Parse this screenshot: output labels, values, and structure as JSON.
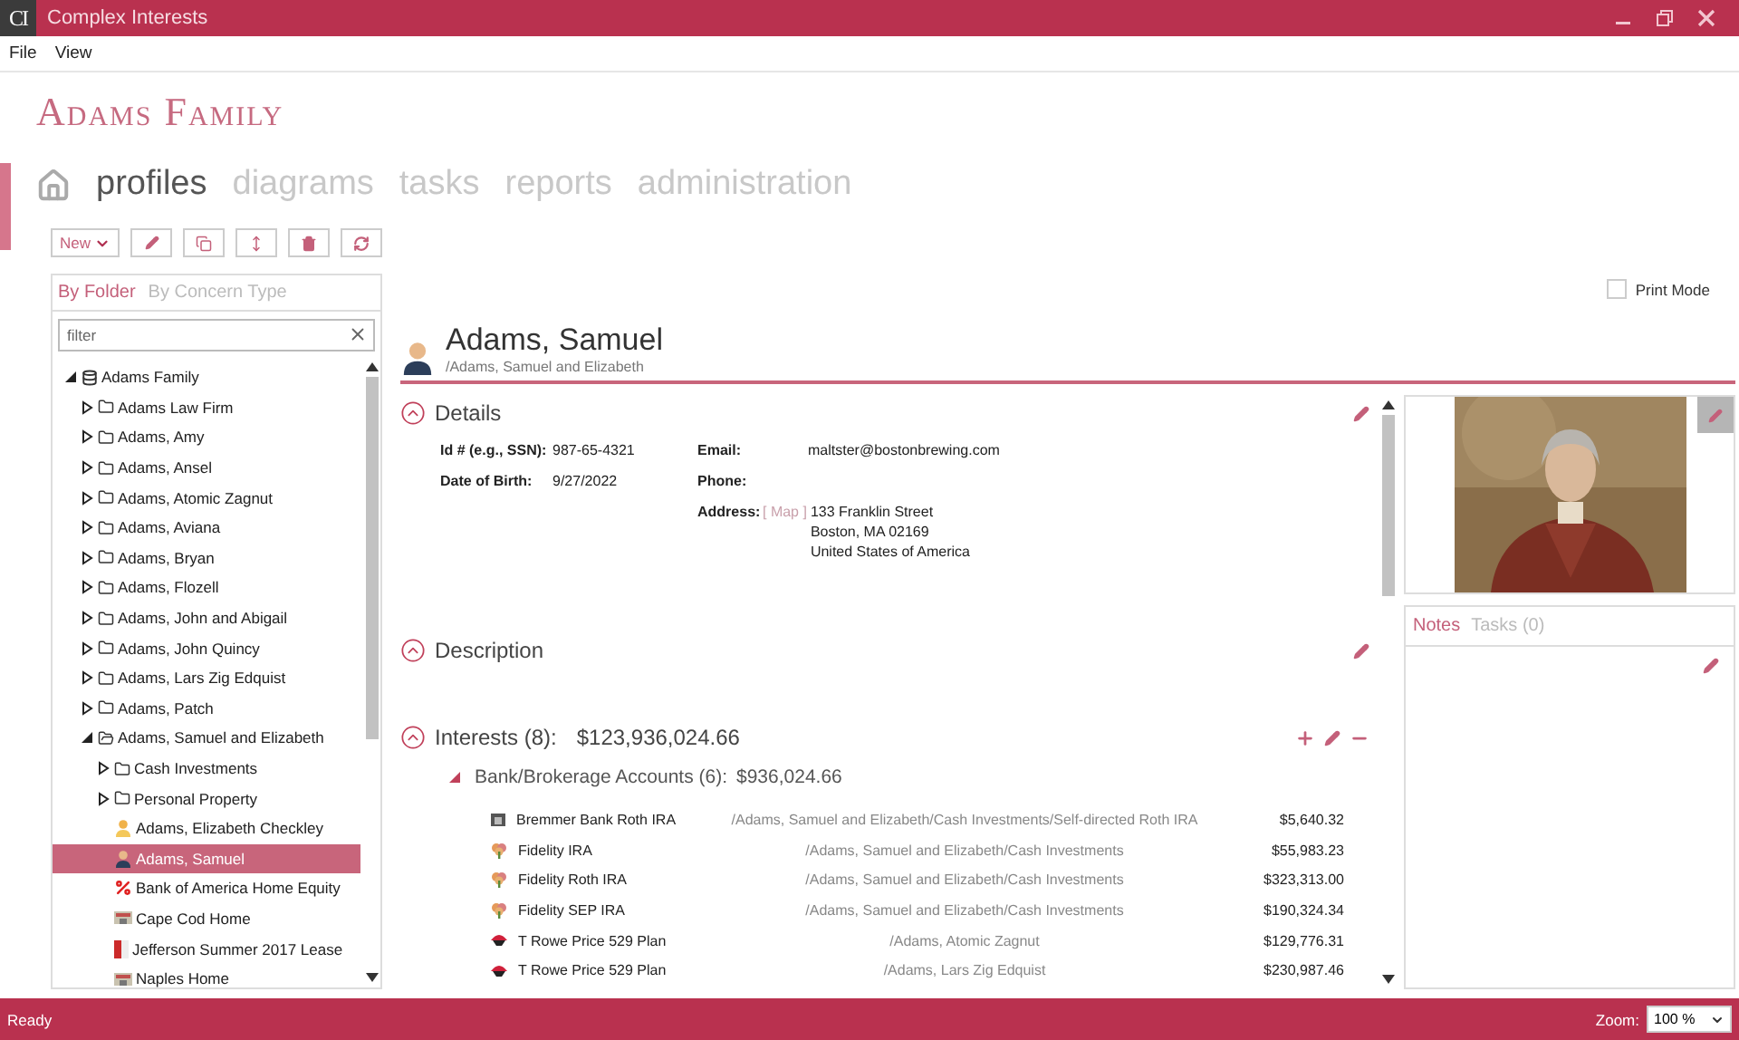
{
  "window": {
    "logo": "CI",
    "title": "Complex Interests"
  },
  "menu": [
    "File",
    "View"
  ],
  "family_title": "Adams Family",
  "nav": [
    {
      "label": "profiles",
      "selected": true
    },
    {
      "label": "diagrams",
      "selected": false
    },
    {
      "label": "tasks",
      "selected": false
    },
    {
      "label": "reports",
      "selected": false
    },
    {
      "label": "administration",
      "selected": false
    }
  ],
  "toolbar": {
    "new_button": "New"
  },
  "sidebar": {
    "tabs": [
      {
        "label": "By Folder",
        "selected": true
      },
      {
        "label": "By Concern Type",
        "selected": false
      }
    ],
    "filter": {
      "placeholder": "filter"
    },
    "tree": [
      {
        "kind": "database",
        "label": "Adams Family",
        "expanded": true,
        "selected": false,
        "children": [
          {
            "kind": "folder",
            "label": "Adams Law Firm",
            "expanded": false,
            "selected": false
          },
          {
            "kind": "folder",
            "label": "Adams, Amy",
            "expanded": false,
            "selected": false
          },
          {
            "kind": "folder",
            "label": "Adams, Ansel",
            "expanded": false,
            "selected": false
          },
          {
            "kind": "folder",
            "label": "Adams, Atomic Zagnut",
            "expanded": false,
            "selected": false
          },
          {
            "kind": "folder",
            "label": "Adams, Aviana",
            "expanded": false,
            "selected": false
          },
          {
            "kind": "folder",
            "label": "Adams, Bryan",
            "expanded": false,
            "selected": false
          },
          {
            "kind": "folder",
            "label": "Adams, Flozell",
            "expanded": false,
            "selected": false
          },
          {
            "kind": "folder",
            "label": "Adams, John and Abigail",
            "expanded": false,
            "selected": false
          },
          {
            "kind": "folder",
            "label": "Adams, John Quincy",
            "expanded": false,
            "selected": false
          },
          {
            "kind": "folder",
            "label": "Adams, Lars Zig Edquist",
            "expanded": false,
            "selected": false
          },
          {
            "kind": "folder",
            "label": "Adams, Patch",
            "expanded": false,
            "selected": false
          },
          {
            "kind": "folder",
            "label": "Adams, Samuel and Elizabeth",
            "expanded": true,
            "selected": false,
            "children": [
              {
                "kind": "folder",
                "label": "Cash Investments",
                "expanded": false,
                "selected": false
              },
              {
                "kind": "folder",
                "label": "Personal Property",
                "expanded": false,
                "selected": false
              },
              {
                "kind": "person_female",
                "label": "Adams, Elizabeth Checkley",
                "selected": false
              },
              {
                "kind": "person_male",
                "label": "Adams, Samuel",
                "selected": true
              },
              {
                "kind": "loan",
                "label": "Bank of America Home Equity",
                "selected": false
              },
              {
                "kind": "property",
                "label": "Cape Cod Home",
                "selected": false
              },
              {
                "kind": "lease",
                "label": "Jefferson Summer 2017 Lease",
                "selected": false
              },
              {
                "kind": "property",
                "label": "Naples Home",
                "selected": false
              }
            ]
          }
        ]
      }
    ]
  },
  "profile": {
    "name": "Adams, Samuel",
    "path": "/Adams, Samuel and Elizabeth",
    "print_mode": {
      "label": "Print Mode",
      "checked": false
    }
  },
  "details": {
    "title": "Details",
    "expanded": true,
    "columns": [
      [
        {
          "kind": "text",
          "label": "Id # (e.g., SSN):",
          "value": "987-65-4321"
        },
        {
          "kind": "text",
          "label": "Date of Birth:",
          "value": "9/27/2022"
        }
      ],
      [
        {
          "kind": "text",
          "label": "Email:",
          "value": "maltster@bostonbrewing.com"
        },
        {
          "kind": "text",
          "label": "Phone:"
        },
        {
          "kind": "address",
          "label": "Address:",
          "link": "[ Map ]",
          "lines": [
            "133 Franklin Street",
            "Boston, MA 02169",
            "United States of America"
          ]
        }
      ]
    ]
  },
  "description": {
    "title": "Description",
    "expanded": true
  },
  "interests": {
    "title": "Interests (8):",
    "total": "$123,936,024.66",
    "expanded": true,
    "groups": [
      {
        "title": "Bank/Brokerage Accounts (6):",
        "total": "$936,024.66",
        "expanded": true,
        "rows": [
          {
            "kind": "bank",
            "name": "Bremmer Bank Roth IRA",
            "path": "/Adams, Samuel and Elizabeth/Cash Investments/Self-directed Roth IRA",
            "amount": "$5,640.32"
          },
          {
            "kind": "fund",
            "name": "Fidelity IRA",
            "path": "/Adams, Samuel and Elizabeth/Cash Investments",
            "amount": "$55,983.23"
          },
          {
            "kind": "fund",
            "name": "Fidelity Roth IRA",
            "path": "/Adams, Samuel and Elizabeth/Cash Investments",
            "amount": "$323,313.00"
          },
          {
            "kind": "fund",
            "name": "Fidelity SEP IRA",
            "path": "/Adams, Samuel and Elizabeth/Cash Investments",
            "amount": "$190,324.34"
          },
          {
            "kind": "plan",
            "name": "T Rowe Price 529 Plan",
            "path": "/Adams, Atomic Zagnut",
            "amount": "$129,776.31"
          },
          {
            "kind": "plan",
            "name": "T Rowe Price 529 Plan",
            "path": "/Adams, Lars Zig Edquist",
            "amount": "$230,987.46"
          }
        ]
      }
    ]
  },
  "photo": {
    "kind": "picture"
  },
  "notes": {
    "tabs": [
      {
        "label": "Notes",
        "selected": true
      },
      {
        "label": "Tasks (0)",
        "selected": false
      }
    ]
  },
  "status_bar": {
    "text": "Ready",
    "zoom_label": "Zoom:",
    "zoom_value": "100 %"
  }
}
